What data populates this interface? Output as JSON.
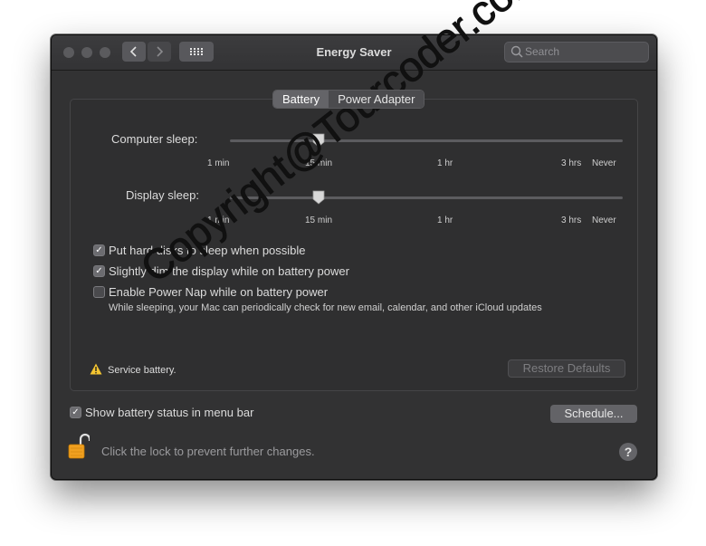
{
  "window": {
    "title": "Energy Saver"
  },
  "search": {
    "placeholder": "Search"
  },
  "tabs": [
    {
      "label": "Battery",
      "selected": true
    },
    {
      "label": "Power Adapter",
      "selected": false
    }
  ],
  "sliders": {
    "computer_sleep": {
      "label": "Computer sleep:",
      "value": "15 min"
    },
    "display_sleep": {
      "label": "Display sleep:",
      "value": "15 min"
    },
    "ticks": [
      "1 min",
      "15 min",
      "1 hr",
      "3 hrs",
      "Never"
    ]
  },
  "options": [
    {
      "label": "Put hard disks to sleep when possible",
      "checked": true
    },
    {
      "label": "Slightly dim the display while on battery power",
      "checked": true
    },
    {
      "label": "Enable Power Nap while on battery power",
      "checked": false
    }
  ],
  "power_nap_note": "While sleeping, your Mac can periodically check for new email, calendar, and other iCloud updates",
  "service": {
    "text": "Service battery."
  },
  "buttons": {
    "restore_defaults": "Restore Defaults",
    "schedule": "Schedule..."
  },
  "show_status": {
    "label": "Show battery status in menu bar",
    "checked": true
  },
  "lock": {
    "text": "Click the lock to prevent further changes."
  },
  "help_label": "?",
  "watermark": "Copyright@Tourcoder.com"
}
